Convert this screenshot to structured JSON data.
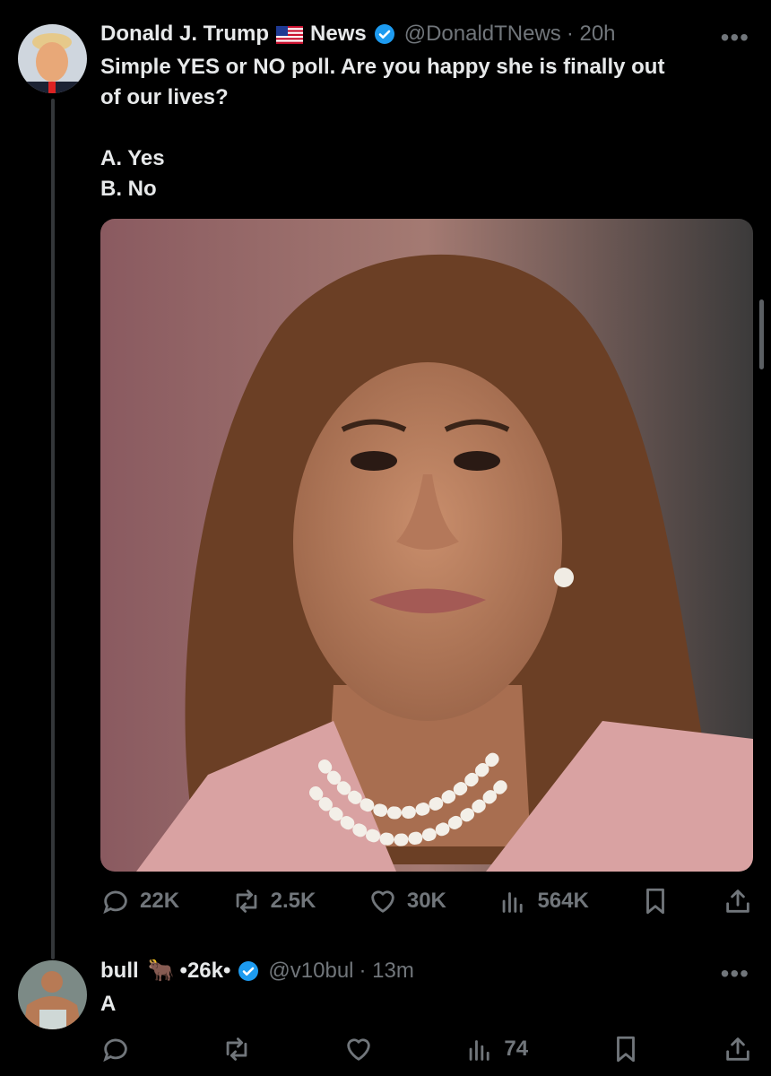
{
  "tweet": {
    "author_name": "Donald J. Trump",
    "author_name_suffix": "News",
    "handle": "@DonaldTNews",
    "time": "· 20h",
    "more_label": "•••",
    "text_lines": [
      "Simple YES or NO poll. Are you happy she is finally out",
      "of our lives?",
      "",
      "A. Yes",
      "B. No"
    ],
    "media_icon": "photo",
    "metrics": {
      "replies": "22K",
      "reposts": "2.5K",
      "likes": "30K",
      "views": "564K"
    }
  },
  "reply": {
    "author_name": "bull",
    "author_emoji": "🐂",
    "author_suffix": "•26k•",
    "handle": "@v10bul",
    "time": "· 13m",
    "more_label": "•••",
    "text": "A",
    "metrics": {
      "replies": "",
      "reposts": "",
      "likes": "",
      "views": "74"
    }
  },
  "colors": {
    "background": "#000000",
    "text_primary": "#e7e9ea",
    "text_secondary": "#71767b",
    "verified_blue": "#1d9bf0",
    "thread_line": "#333639"
  }
}
